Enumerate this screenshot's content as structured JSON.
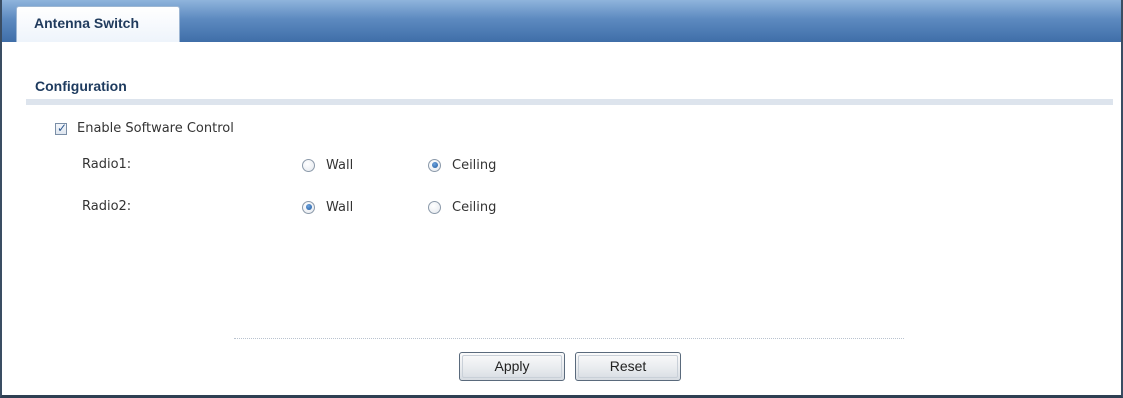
{
  "tabs": [
    {
      "label": "Antenna Switch",
      "active": true
    }
  ],
  "section": {
    "title": "Configuration"
  },
  "software_control": {
    "label": "Enable Software Control",
    "checked": true
  },
  "radios": [
    {
      "label": "Radio1:",
      "options": [
        {
          "label": "Wall",
          "selected": false
        },
        {
          "label": "Ceiling",
          "selected": true
        }
      ]
    },
    {
      "label": "Radio2:",
      "options": [
        {
          "label": "Wall",
          "selected": true
        },
        {
          "label": "Ceiling",
          "selected": false
        }
      ]
    }
  ],
  "buttons": {
    "apply": "Apply",
    "reset": "Reset"
  },
  "colors": {
    "tabbar": "#4f7cb5",
    "accent": "#1f5aa0",
    "section_title": "#1d3a5e"
  },
  "icons": {
    "checkbox": "checkmark-icon",
    "radio": "radio-dot-icon"
  }
}
